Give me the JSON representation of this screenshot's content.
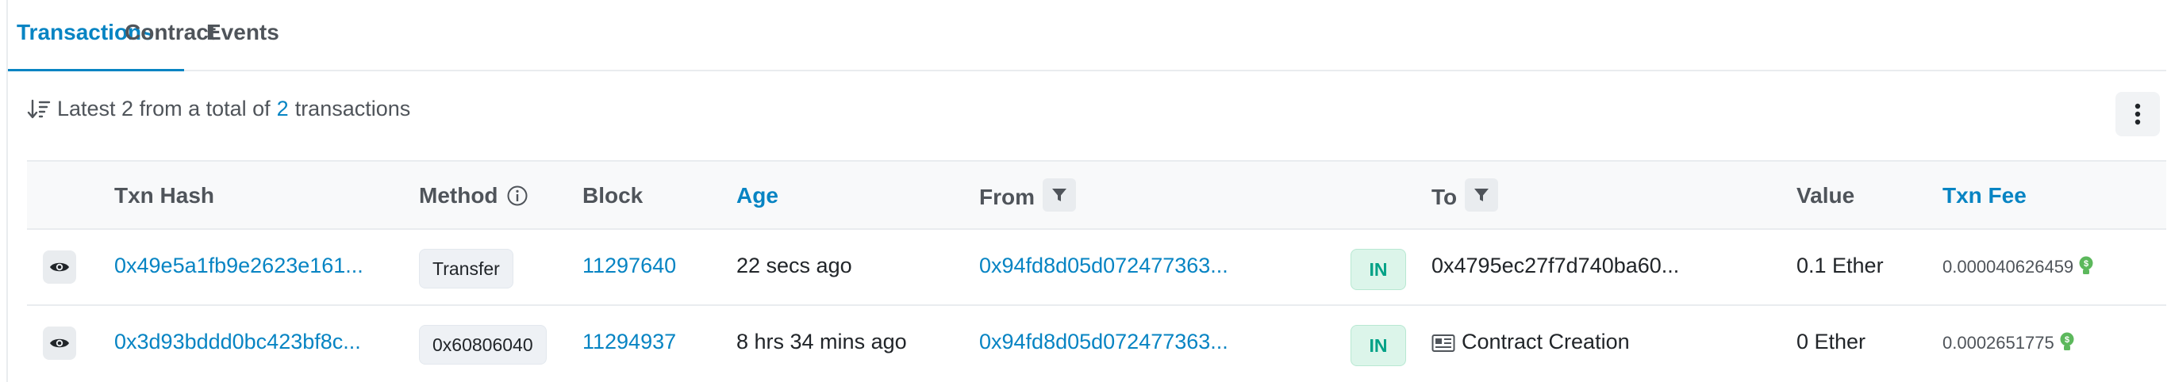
{
  "tabs": [
    {
      "label": "Transactions",
      "active": true
    },
    {
      "label": "Contract",
      "active": false
    },
    {
      "label": "Events",
      "active": false
    }
  ],
  "summary": {
    "prefix": "Latest 2 from a total of",
    "count": "2",
    "suffix": "transactions"
  },
  "table": {
    "headers": {
      "txn_hash": "Txn Hash",
      "method": "Method",
      "block": "Block",
      "age": "Age",
      "from": "From",
      "to": "To",
      "value": "Value",
      "txn_fee": "Txn Fee"
    },
    "rows": [
      {
        "txn_hash": "0x49e5a1fb9e2623e161...",
        "method": "Transfer",
        "block": "11297640",
        "age": "22 secs ago",
        "from": "0x94fd8d05d072477363...",
        "direction": "IN",
        "to": "0x4795ec27f7d740ba60...",
        "to_is_contract_creation": false,
        "value": "0.1 Ether",
        "fee": "0.000040626459"
      },
      {
        "txn_hash": "0x3d93bddd0bc423bf8c...",
        "method": "0x60806040",
        "block": "11294937",
        "age": "8 hrs 34 mins ago",
        "from": "0x94fd8d05d072477363...",
        "direction": "IN",
        "to": "Contract Creation",
        "to_is_contract_creation": true,
        "value": "0 Ether",
        "fee": "0.0002651775"
      }
    ]
  },
  "colors": {
    "accent": "#0784c3",
    "in_badge_bg": "#dcf5ea",
    "in_badge_text": "#00a186",
    "gas_icon": "#5cb85c"
  },
  "icons": {
    "sort": "sort-descending-icon",
    "more": "vertical-ellipsis-icon",
    "info": "info-circle-icon",
    "filter": "filter-icon",
    "eye": "eye-icon",
    "contract": "contract-document-icon",
    "gas": "gas-bulb-icon"
  }
}
